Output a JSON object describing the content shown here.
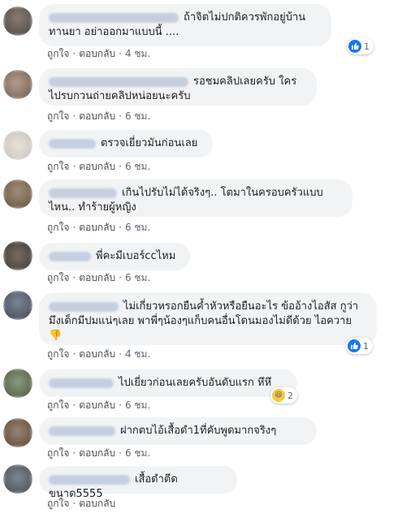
{
  "labels": {
    "like": "ถูกใจ",
    "reply": "ตอบกลับ",
    "dot": "·"
  },
  "comments": [
    {
      "text": "ถ้าจิตไม่ปกติควรพักอยู่บ้าน ทานยา อย่าออกมาแบบนี้ ....",
      "time": "4 ชม.",
      "reaction": {
        "icon": "like-icon",
        "count": "1"
      }
    },
    {
      "text": "รอชมคลิปเลยครับ ใครไปรบกวนถ่ายคลิปหน่อยนะครับ",
      "time": "6 ชม."
    },
    {
      "text": "ตรวจเยี่ยวมันก่อนเลย",
      "time": "6 ชม."
    },
    {
      "text": "เกินไปรับไม่ได้จริงๆ.. โตมาในครอบครัวแบบไหน.. ทำร้ายผู้หญิง",
      "time": "6 ชม."
    },
    {
      "text": "พี่คะมีเบอร์ccไหม",
      "time": "6 ชม."
    },
    {
      "text": "ไม่เกี่ยวหรอกยืนค้ำหัวหรือยืนอะไร ข้ออ้างไอสัส กูว่ามึงเด็กมีปมแน่ๆเลย พาพี่ๆน้องๆแก็บคนอื่นโดนมองไม่ดีด้วย ไอควาย 👎",
      "time": "4 ชม.",
      "reaction": {
        "icon": "like-icon",
        "count": "1"
      }
    },
    {
      "text": "ไปเยี่ยวก่อนเลยครับอันดับแรก หึหึ",
      "time": "6 ชม.",
      "reaction": {
        "icon": "haha-icon",
        "count": "2"
      }
    },
    {
      "text": "ฝากตบไอ้เสื้อดำ1ที่คับพูดมากจริงๆ",
      "time": "6 ชม."
    },
    {
      "text": "เสื้อดำตีดขนาด5555",
      "time": ""
    }
  ]
}
